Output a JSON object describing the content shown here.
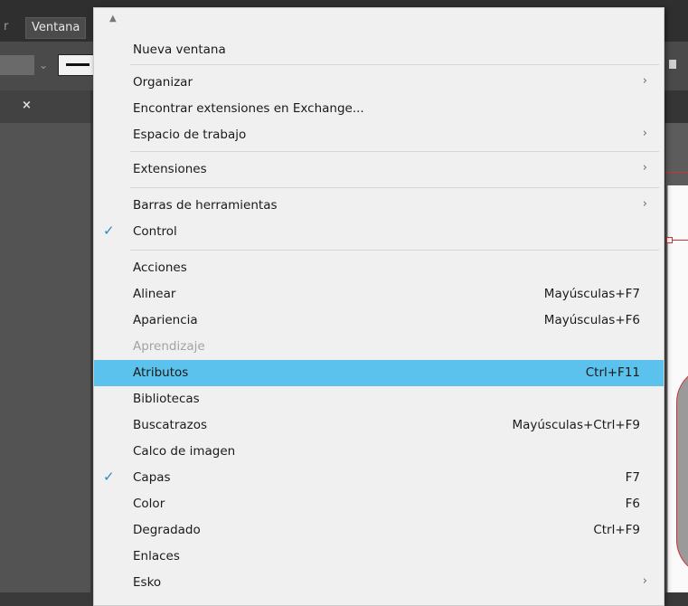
{
  "app": {
    "menubar_prev": "r",
    "menubar_active": "Ventana",
    "close_tab": "×"
  },
  "menu": {
    "scroll_up": "▲",
    "items": [
      {
        "label": "Nueva ventana",
        "shortcut": "",
        "submenu": false,
        "checked": false,
        "disabled": false,
        "highlighted": false
      },
      {
        "label": "Organizar",
        "shortcut": "",
        "submenu": true,
        "checked": false,
        "disabled": false,
        "highlighted": false
      },
      {
        "label": "Encontrar extensiones en Exchange...",
        "shortcut": "",
        "submenu": false,
        "checked": false,
        "disabled": false,
        "highlighted": false
      },
      {
        "label": "Espacio de trabajo",
        "shortcut": "",
        "submenu": true,
        "checked": false,
        "disabled": false,
        "highlighted": false
      },
      {
        "label": "Extensiones",
        "shortcut": "",
        "submenu": true,
        "checked": false,
        "disabled": false,
        "highlighted": false
      },
      {
        "label": "Barras de herramientas",
        "shortcut": "",
        "submenu": true,
        "checked": false,
        "disabled": false,
        "highlighted": false
      },
      {
        "label": "Control",
        "shortcut": "",
        "submenu": false,
        "checked": true,
        "disabled": false,
        "highlighted": false
      },
      {
        "label": "Acciones",
        "shortcut": "",
        "submenu": false,
        "checked": false,
        "disabled": false,
        "highlighted": false
      },
      {
        "label": "Alinear",
        "shortcut": "Mayúsculas+F7",
        "submenu": false,
        "checked": false,
        "disabled": false,
        "highlighted": false
      },
      {
        "label": "Apariencia",
        "shortcut": "Mayúsculas+F6",
        "submenu": false,
        "checked": false,
        "disabled": false,
        "highlighted": false
      },
      {
        "label": "Aprendizaje",
        "shortcut": "",
        "submenu": false,
        "checked": false,
        "disabled": true,
        "highlighted": false
      },
      {
        "label": "Atributos",
        "shortcut": "Ctrl+F11",
        "submenu": false,
        "checked": false,
        "disabled": false,
        "highlighted": true
      },
      {
        "label": "Bibliotecas",
        "shortcut": "",
        "submenu": false,
        "checked": false,
        "disabled": false,
        "highlighted": false
      },
      {
        "label": "Buscatrazos",
        "shortcut": "Mayúsculas+Ctrl+F9",
        "submenu": false,
        "checked": false,
        "disabled": false,
        "highlighted": false
      },
      {
        "label": "Calco de imagen",
        "shortcut": "",
        "submenu": false,
        "checked": false,
        "disabled": false,
        "highlighted": false
      },
      {
        "label": "Capas",
        "shortcut": "F7",
        "submenu": false,
        "checked": true,
        "disabled": false,
        "highlighted": false
      },
      {
        "label": "Color",
        "shortcut": "F6",
        "submenu": false,
        "checked": false,
        "disabled": false,
        "highlighted": false
      },
      {
        "label": "Degradado",
        "shortcut": "Ctrl+F9",
        "submenu": false,
        "checked": false,
        "disabled": false,
        "highlighted": false
      },
      {
        "label": "Enlaces",
        "shortcut": "",
        "submenu": false,
        "checked": false,
        "disabled": false,
        "highlighted": false
      },
      {
        "label": "Esko",
        "shortcut": "",
        "submenu": true,
        "checked": false,
        "disabled": false,
        "highlighted": false
      }
    ]
  },
  "icons": {
    "check": "check-icon",
    "submenu": "chevron-right-icon",
    "scroll": "scroll-up-icon"
  },
  "colors": {
    "highlight": "#5ac2ec",
    "check": "#2a89c8",
    "menu_bg": "#f0f0f0"
  }
}
